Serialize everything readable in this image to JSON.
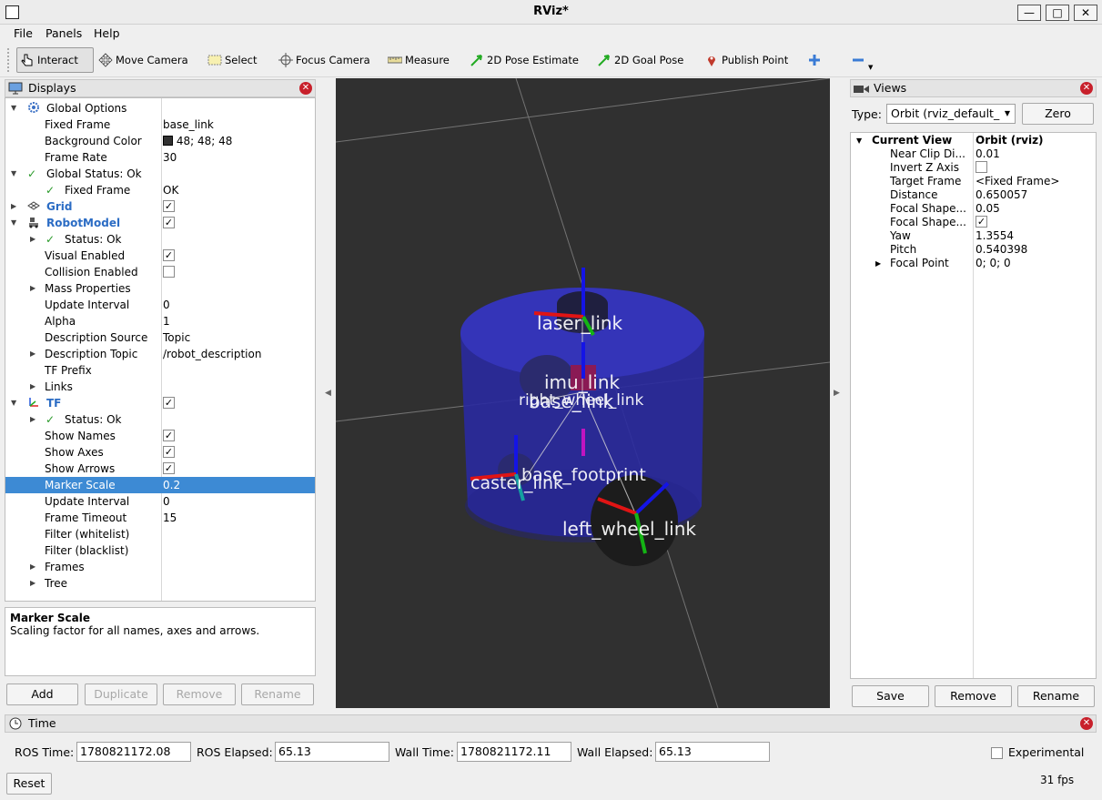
{
  "window": {
    "title": "RViz*",
    "minimize": "—",
    "maximize": "□",
    "close": "✕"
  },
  "menu": [
    "File",
    "Panels",
    "Help"
  ],
  "toolbar": {
    "interact": "Interact",
    "move_camera": "Move Camera",
    "select": "Select",
    "focus_camera": "Focus Camera",
    "measure": "Measure",
    "pose_estimate": "2D Pose Estimate",
    "goal_pose": "2D Goal Pose",
    "publish_point": "Publish Point"
  },
  "displays": {
    "title": "Displays",
    "rows": [
      {
        "label": "Global Options",
        "value": ""
      },
      {
        "label": "Fixed Frame",
        "value": "base_link"
      },
      {
        "label": "Background Color",
        "value": "48; 48; 48"
      },
      {
        "label": "Frame Rate",
        "value": "30"
      },
      {
        "label": "Global Status: Ok",
        "value": ""
      },
      {
        "label": "Fixed Frame",
        "value": "OK"
      },
      {
        "label": "Grid",
        "value": ""
      },
      {
        "label": "RobotModel",
        "value": ""
      },
      {
        "label": "Status: Ok",
        "value": ""
      },
      {
        "label": "Visual Enabled",
        "value": ""
      },
      {
        "label": "Collision Enabled",
        "value": ""
      },
      {
        "label": "Mass Properties",
        "value": ""
      },
      {
        "label": "Update Interval",
        "value": "0"
      },
      {
        "label": "Alpha",
        "value": "1"
      },
      {
        "label": "Description Source",
        "value": "Topic"
      },
      {
        "label": "Description Topic",
        "value": "/robot_description"
      },
      {
        "label": "TF Prefix",
        "value": ""
      },
      {
        "label": "Links",
        "value": ""
      },
      {
        "label": "TF",
        "value": ""
      },
      {
        "label": "Status: Ok",
        "value": ""
      },
      {
        "label": "Show Names",
        "value": ""
      },
      {
        "label": "Show Axes",
        "value": ""
      },
      {
        "label": "Show Arrows",
        "value": ""
      },
      {
        "label": "Marker Scale",
        "value": "0.2"
      },
      {
        "label": "Update Interval",
        "value": "0"
      },
      {
        "label": "Frame Timeout",
        "value": "15"
      },
      {
        "label": "Filter (whitelist)",
        "value": ""
      },
      {
        "label": "Filter (blacklist)",
        "value": ""
      },
      {
        "label": "Frames",
        "value": ""
      },
      {
        "label": "Tree",
        "value": ""
      }
    ],
    "checkmark": "✓",
    "bg_color": "#303030",
    "description_title": "Marker Scale",
    "description_text": "Scaling factor for all names, axes and arrows.",
    "buttons": {
      "add": "Add",
      "duplicate": "Duplicate",
      "remove": "Remove",
      "rename": "Rename"
    }
  },
  "viewport": {
    "labels": [
      "laser_link",
      "imu_link",
      "right_wheel_link",
      "base_link",
      "base_footprint",
      "caster_link",
      "left_wheel_link"
    ]
  },
  "views": {
    "title": "Views",
    "type_label": "Type:",
    "type_value": "Orbit (rviz_default_",
    "zero": "Zero",
    "rows": [
      {
        "label": "Current View",
        "value": "Orbit (rviz)"
      },
      {
        "label": "Near Clip Di...",
        "value": "0.01"
      },
      {
        "label": "Invert Z Axis",
        "value": ""
      },
      {
        "label": "Target Frame",
        "value": "<Fixed Frame>"
      },
      {
        "label": "Distance",
        "value": "0.650057"
      },
      {
        "label": "Focal Shape...",
        "value": "0.05"
      },
      {
        "label": "Focal Shape...",
        "value": ""
      },
      {
        "label": "Yaw",
        "value": "1.3554"
      },
      {
        "label": "Pitch",
        "value": "0.540398"
      },
      {
        "label": "Focal Point",
        "value": "0; 0; 0"
      }
    ],
    "buttons": {
      "save": "Save",
      "remove": "Remove",
      "rename": "Rename"
    }
  },
  "time": {
    "title": "Time",
    "ros_time_label": "ROS Time:",
    "ros_time": "1780821172.08",
    "ros_elapsed_label": "ROS Elapsed:",
    "ros_elapsed": "65.13",
    "wall_time_label": "Wall Time:",
    "wall_time": "1780821172.11",
    "wall_elapsed_label": "Wall Elapsed:",
    "wall_elapsed": "65.13",
    "experimental": "Experimental",
    "reset": "Reset",
    "fps": "31 fps"
  }
}
